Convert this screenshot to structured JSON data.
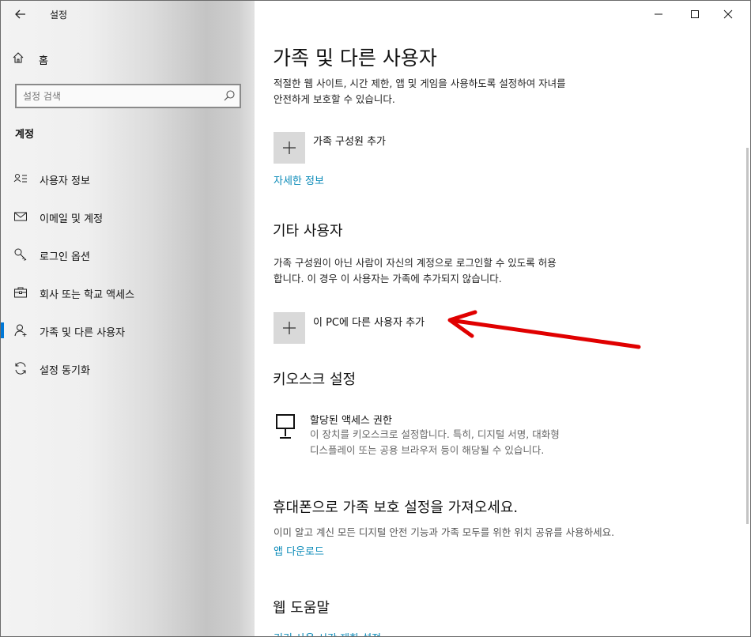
{
  "window": {
    "app_title": "설정",
    "controls": [
      "minimize",
      "maximize",
      "close"
    ]
  },
  "sidebar": {
    "home_label": "홈",
    "search_placeholder": "설정 검색",
    "section_label": "계정",
    "items": [
      {
        "label": "사용자 정보",
        "icon": "person-card-icon"
      },
      {
        "label": "이메일 및 계정",
        "icon": "mail-icon"
      },
      {
        "label": "로그인 옵션",
        "icon": "key-icon"
      },
      {
        "label": "회사 또는 학교 액세스",
        "icon": "briefcase-icon"
      },
      {
        "label": "가족 및 다른 사용자",
        "icon": "person-add-icon",
        "active": true
      },
      {
        "label": "설정 동기화",
        "icon": "sync-icon"
      }
    ]
  },
  "main": {
    "title": "가족 및 다른 사용자",
    "intro_line1": "적절한 웹 사이트, 시간 제한, 앱 및 게임을 사용하도록 설정하여 자녀를",
    "intro_line2": "안전하게 보호할 수 있습니다.",
    "add_family_label": "가족 구성원 추가",
    "more_info_link": "자세한 정보",
    "other_users_title": "기타 사용자",
    "other_users_line1": "가족 구성원이 아닌 사람이 자신의 계정으로 로그인할 수 있도록 허용",
    "other_users_line2": "합니다. 이 경우 이 사용자는 가족에 추가되지 않습니다.",
    "add_other_label": "이 PC에 다른 사용자 추가",
    "kiosk_title": "키오스크 설정",
    "kiosk_item_title": "할당된 액세스 권한",
    "kiosk_item_line1": "이 장치를 키오스크로 설정합니다. 특히, 디지털 서명, 대화형",
    "kiosk_item_line2": "디스플레이 또는 공용 브라우저 등이 해당될 수 있습니다.",
    "phone_title": "휴대폰으로 가족 보호 설정을 가져오세요.",
    "phone_desc": "이미 알고 계신 모든 디지털 안전 기능과 가족 모두를 위한 위치 공유를 사용하세요.",
    "app_download_link": "앱 다운로드",
    "web_help_title": "웹 도움말",
    "cut_off_link": "기기 사용 시간 제한 설정"
  },
  "colors": {
    "accent": "#0078d7",
    "link": "#0a8ab8",
    "arrow": "#e00000"
  }
}
